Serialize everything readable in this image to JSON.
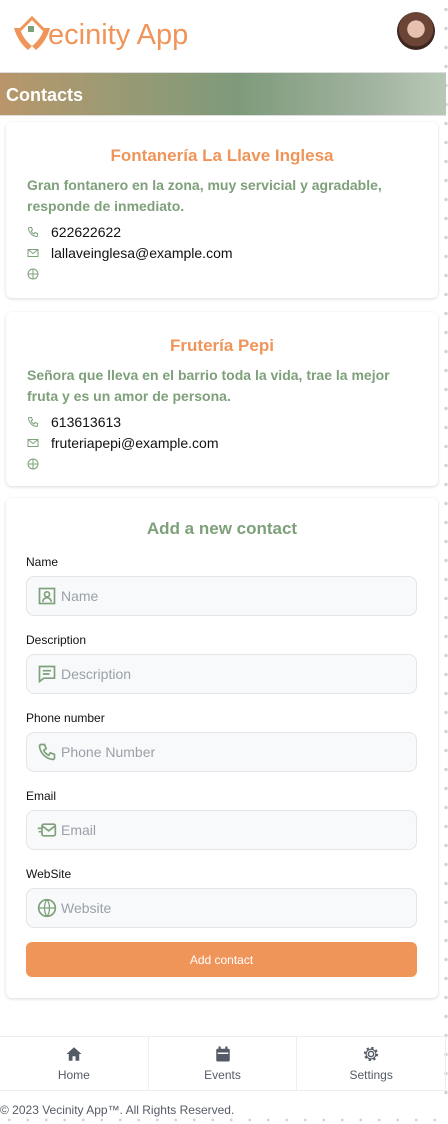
{
  "app": {
    "logo_text": "ecinity App",
    "logo_full": "Vecinity App"
  },
  "banner": {
    "title": "Contacts"
  },
  "contacts": [
    {
      "name": "Fontanería La Llave Inglesa",
      "description": "Gran fontanero en la zona, muy servicial y agradable, responde de inmediato.",
      "phone": "622622622",
      "email": "lallaveinglesa@example.com"
    },
    {
      "name": "Frutería Pepi",
      "description": "Señora que lleva en el barrio toda la vida, trae la mejor fruta y es un amor de persona.",
      "phone": "613613613",
      "email": "fruteriapepi@example.com"
    }
  ],
  "form": {
    "title": "Add a new contact",
    "fields": [
      {
        "label": "Name",
        "placeholder": "Name"
      },
      {
        "label": "Description",
        "placeholder": "Description"
      },
      {
        "label": "Phone number",
        "placeholder": "Phone Number"
      },
      {
        "label": "Email",
        "placeholder": "Email"
      },
      {
        "label": "WebSite",
        "placeholder": "Website"
      }
    ],
    "submit": "Add contact"
  },
  "nav": [
    {
      "label": "Home"
    },
    {
      "label": "Events"
    },
    {
      "label": "Settings"
    }
  ],
  "footer": "© 2023 Vecinity App™. All Rights Reserved.",
  "colors": {
    "accent": "#f0955a",
    "green": "#7ea07a"
  }
}
